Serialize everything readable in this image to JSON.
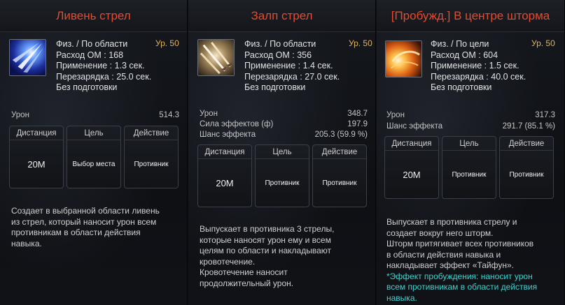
{
  "panels": [
    {
      "title": "Ливень стрел",
      "icon": "arrow-rain-skill-icon",
      "level": "Ур. 50",
      "info": [
        "Физ. / По области",
        "Расход ОМ : 168",
        "Применение : 1.3 сек.",
        "Перезарядка : 25.0 сек.",
        "Без подготовки"
      ],
      "stats": [
        {
          "label": "Урон",
          "value": "514.3"
        }
      ],
      "boxes": [
        {
          "header": "Дистанция",
          "value": "20M"
        },
        {
          "header": "Цель",
          "value": "Выбор места"
        },
        {
          "header": "Действие",
          "value": "Противник"
        }
      ],
      "description": [
        "Создает в выбранной области ливень",
        "из стрел, который наносит урон всем",
        "противникам в области действия",
        "навыка."
      ]
    },
    {
      "title": "Залп стрел",
      "icon": "arrow-volley-skill-icon",
      "level": "Ур. 50",
      "info": [
        "Физ. / По области",
        "Расход ОМ : 356",
        "Применение : 1.4 сек.",
        "Перезарядка : 27.0 сек.",
        "Без подготовки"
      ],
      "stats": [
        {
          "label": "Урон",
          "value": "348.7"
        },
        {
          "label": "Сила эффектов (ф)",
          "value": "197.9"
        },
        {
          "label": "Шанс эффекта",
          "value": "205.3 (59.9 %)"
        }
      ],
      "boxes": [
        {
          "header": "Дистанция",
          "value": "20M"
        },
        {
          "header": "Цель",
          "value": "Противник"
        },
        {
          "header": "Действие",
          "value": "Противник"
        }
      ],
      "description": [
        "Выпускает в противника 3 стрелы,",
        "которые наносят урон ему и всем",
        "целям по области и накладывают",
        "кровотечение.",
        "Кровотечение наносит",
        "продолжительный урон."
      ]
    },
    {
      "title_tag": "[Пробужд.]",
      "title": " В центре шторма",
      "icon": "storm-center-skill-icon",
      "level": "Ур. 50",
      "info": [
        "Физ. / По цели",
        "Расход ОМ : 604",
        "Применение : 1.5 сек.",
        "Перезарядка : 40.0 сек.",
        "Без подготовки"
      ],
      "stats": [
        {
          "label": "Урон",
          "value": "317.3"
        },
        {
          "label": "Шанс эффекта",
          "value": "291.7 (85.1 %)"
        }
      ],
      "boxes": [
        {
          "header": "Дистанция",
          "value": "20M"
        },
        {
          "header": "Цель",
          "value": "Противник"
        },
        {
          "header": "Действие",
          "value": "Противник"
        }
      ],
      "description": [
        "Выпускает в противника стрелу и",
        "создает вокруг него шторм.",
        "Шторм притягивает всех противников",
        "в области действия навыка и",
        "накладывает эффект «Тайфун»."
      ],
      "awakening": [
        "*Эффект пробуждения: наносит урон",
        "всем противникам в области действия",
        "навыка."
      ]
    }
  ],
  "colors": {
    "title": "#e74a2e",
    "level": "#e0b35a",
    "awakening": "#3ed3d0"
  }
}
